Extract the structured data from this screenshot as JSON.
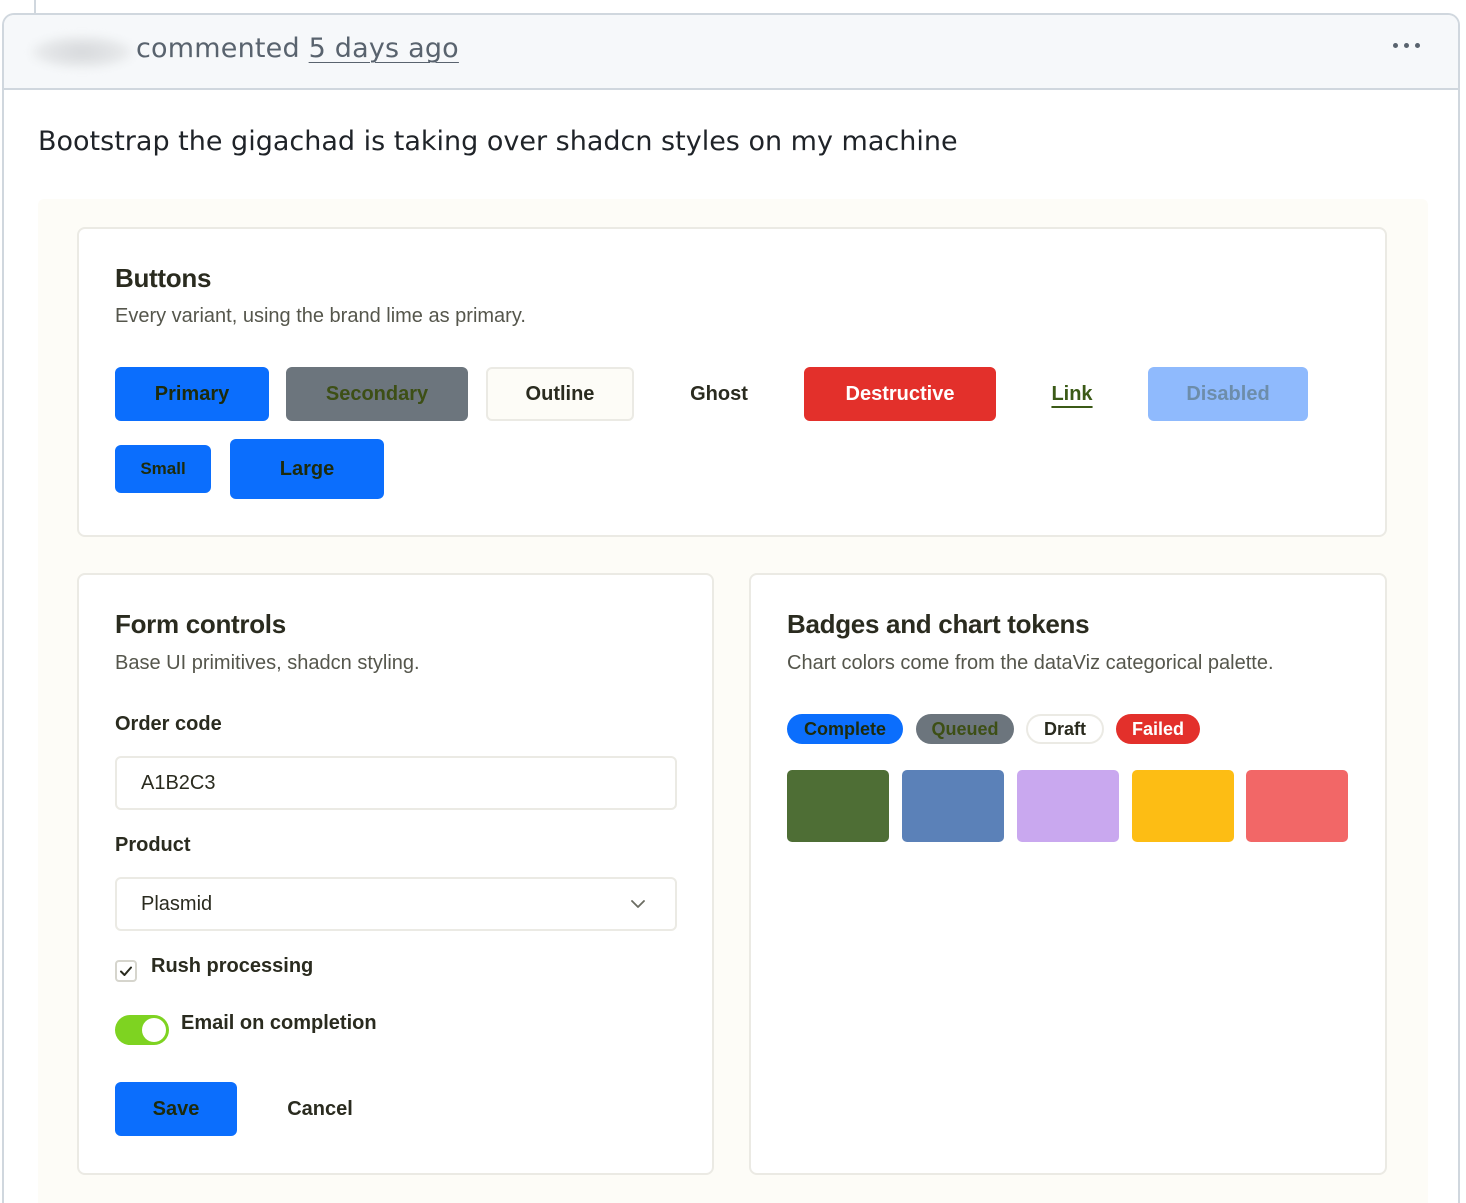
{
  "comment": {
    "action": "commented",
    "time": "5 days ago",
    "body": "Bootstrap the gigachad is taking over shadcn styles on my machine"
  },
  "buttons_card": {
    "title": "Buttons",
    "description": "Every variant, using the brand lime as primary.",
    "primary": "Primary",
    "secondary": "Secondary",
    "outline": "Outline",
    "ghost": "Ghost",
    "destructive": "Destructive",
    "link": "Link",
    "disabled": "Disabled",
    "small": "Small",
    "large": "Large"
  },
  "form_card": {
    "title": "Form controls",
    "description": "Base UI primitives, shadcn styling.",
    "order_code_label": "Order code",
    "order_code_value": "A1B2C3",
    "product_label": "Product",
    "product_value": "Plasmid",
    "rush_label": "Rush processing",
    "rush_checked": true,
    "email_label": "Email on completion",
    "email_on": true,
    "save": "Save",
    "cancel": "Cancel"
  },
  "badges_card": {
    "title": "Badges and chart tokens",
    "description": "Chart colors come from the dataViz categorical palette.",
    "badges": [
      "Complete",
      "Queued",
      "Draft",
      "Failed"
    ],
    "swatch_colors": [
      "#4e6e35",
      "#5b81b8",
      "#c9a8ef",
      "#fdbd14",
      "#f26767"
    ]
  },
  "colors": {
    "primary": "#0b6efd",
    "secondary": "#6c757d",
    "destructive": "#e3302b",
    "toggle": "#7ed321"
  }
}
